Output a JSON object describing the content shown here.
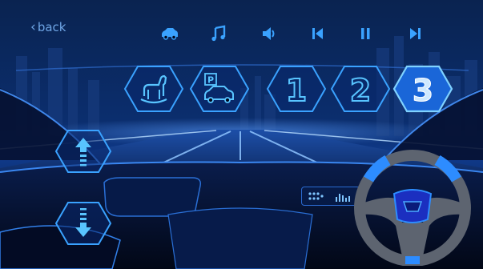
{
  "header": {
    "back_label": "back"
  },
  "media_controls": [
    {
      "icon": "car-icon",
      "action": "vehicle"
    },
    {
      "icon": "music-note-icon",
      "action": "music"
    },
    {
      "icon": "volume-icon",
      "action": "volume"
    },
    {
      "icon": "skip-previous-icon",
      "action": "previous"
    },
    {
      "icon": "pause-icon",
      "action": "pause"
    },
    {
      "icon": "skip-next-icon",
      "action": "next"
    }
  ],
  "mode_buttons": [
    {
      "icon": "rocking-horse-icon",
      "name": "kid-mode"
    },
    {
      "icon": "parking-car-icon",
      "name": "parking"
    },
    {
      "icon": "gear-1-icon",
      "name": "gear-1",
      "text": "1"
    },
    {
      "icon": "gear-2-icon",
      "name": "gear-2",
      "text": "2"
    },
    {
      "icon": "gear-3-icon",
      "name": "gear-3",
      "text": "3",
      "selected": true
    }
  ],
  "parking_sign_text": "P",
  "gear_controls": [
    {
      "icon": "shift-up-icon",
      "name": "shift-up"
    },
    {
      "icon": "shift-down-icon",
      "name": "shift-down"
    }
  ],
  "colors": {
    "accent": "#3aa2ff",
    "accent_glow": "#58c4ff",
    "selected_fill": "#1a66d8",
    "background": "#02081c",
    "wheel_rim": "#5d6470",
    "wheel_accent": "#2d8cff"
  }
}
